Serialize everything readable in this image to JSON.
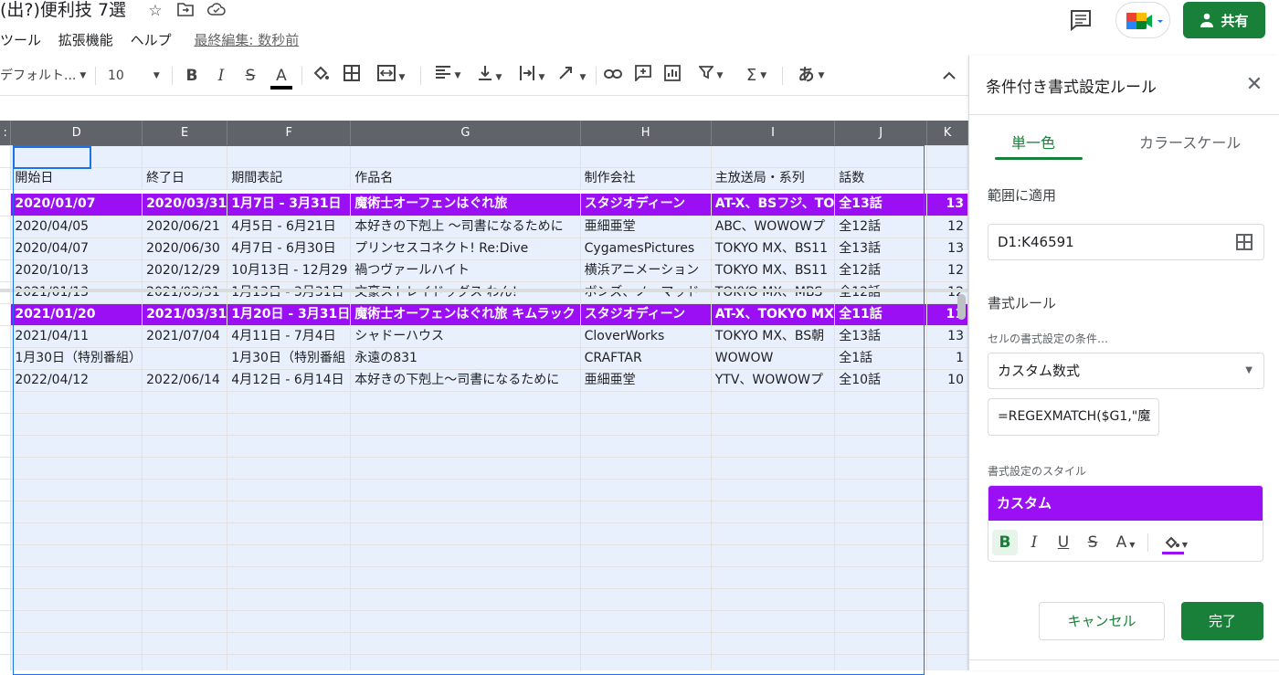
{
  "doc": {
    "title": "(出?)便利技 7選",
    "menus": [
      "ツール",
      "拡張機能",
      "ヘルプ"
    ],
    "last_edit": "最終編集: 数秒前",
    "share_label": "共有"
  },
  "toolbar": {
    "font": "デフォルト...",
    "font_size": "10",
    "text_color": "#000000",
    "input_tool": "あ"
  },
  "grid": {
    "columns": [
      "D",
      "E",
      "F",
      "G",
      "H",
      "I",
      "J",
      "K"
    ],
    "header_row": [
      "開始日",
      "終了日",
      "期間表記",
      "作品名",
      "制作会社",
      "主放送局・系列",
      "話数",
      ""
    ],
    "rows": [
      {
        "highlight": true,
        "cells": [
          "2020/01/07",
          "2020/03/31",
          "1月7日 - 3月31日",
          "魔術士オーフェンはぐれ旅",
          "スタジオディーン",
          "AT-X、BSフジ、TO",
          "全13話",
          "13"
        ]
      },
      {
        "highlight": false,
        "cells": [
          "2020/04/05",
          "2020/06/21",
          "4月5日 - 6月21日",
          "本好きの下剋上 〜司書になるために",
          "亜細亜堂",
          "ABC、WOWOWプ",
          "全12話",
          "12"
        ]
      },
      {
        "highlight": false,
        "cells": [
          "2020/04/07",
          "2020/06/30",
          "4月7日 - 6月30日",
          "プリンセスコネクト! Re:Dive",
          "CygamesPictures",
          "TOKYO MX、BS11",
          "全13話",
          "13"
        ]
      },
      {
        "highlight": false,
        "cells": [
          "2020/10/13",
          "2020/12/29",
          "10月13日 - 12月29",
          "禍つヴァールハイト",
          "横浜アニメーション",
          "TOKYO MX、BS11",
          "全12話",
          "12"
        ]
      },
      {
        "highlight": false,
        "cells": [
          "2021/01/13",
          "2021/03/31",
          "1月13日 - 3月31日",
          "文豪ストレイドッグス わん!",
          "ボンズ、ノーマッド",
          "TOKYO MX、MBS",
          "全12話",
          "12"
        ]
      },
      {
        "highlight": true,
        "cells": [
          "2021/01/20",
          "2021/03/31",
          "1月20日 - 3月31日",
          "魔術士オーフェンはぐれ旅 キムラック",
          "スタジオディーン",
          "AT-X、TOKYO MX",
          "全11話",
          "11"
        ]
      },
      {
        "highlight": false,
        "cells": [
          "2021/04/11",
          "2021/07/04",
          "4月11日 - 7月4日",
          "シャドーハウス",
          "CloverWorks",
          "TOKYO MX、BS朝",
          "全13話",
          "13"
        ]
      },
      {
        "highlight": false,
        "cells": [
          "1月30日（特別番組）",
          "",
          "1月30日（特別番組",
          "永遠の831",
          "CRAFTAR",
          "WOWOW",
          "全1話",
          "1"
        ]
      },
      {
        "highlight": false,
        "cells": [
          "2022/04/12",
          "2022/06/14",
          "4月12日 - 6月14日",
          "本好きの下剋上〜司書になるために",
          "亜細亜堂",
          "YTV、WOWOWプ",
          "全10話",
          "10"
        ]
      }
    ]
  },
  "panel": {
    "title": "条件付き書式設定ルール",
    "tabs": [
      "単一色",
      "カラースケール"
    ],
    "range_label": "範囲に適用",
    "range_value": "D1:K46591",
    "rules_label": "書式ルール",
    "condition_label": "セルの書式設定の条件…",
    "condition_value": "カスタム数式",
    "formula_value": "=REGEXMATCH($G1,\"魔",
    "style_label": "書式設定のスタイル",
    "style_preview": "カスタム",
    "style_color": "#9b0ff5",
    "cancel_label": "キャンセル",
    "done_label": "完了"
  }
}
